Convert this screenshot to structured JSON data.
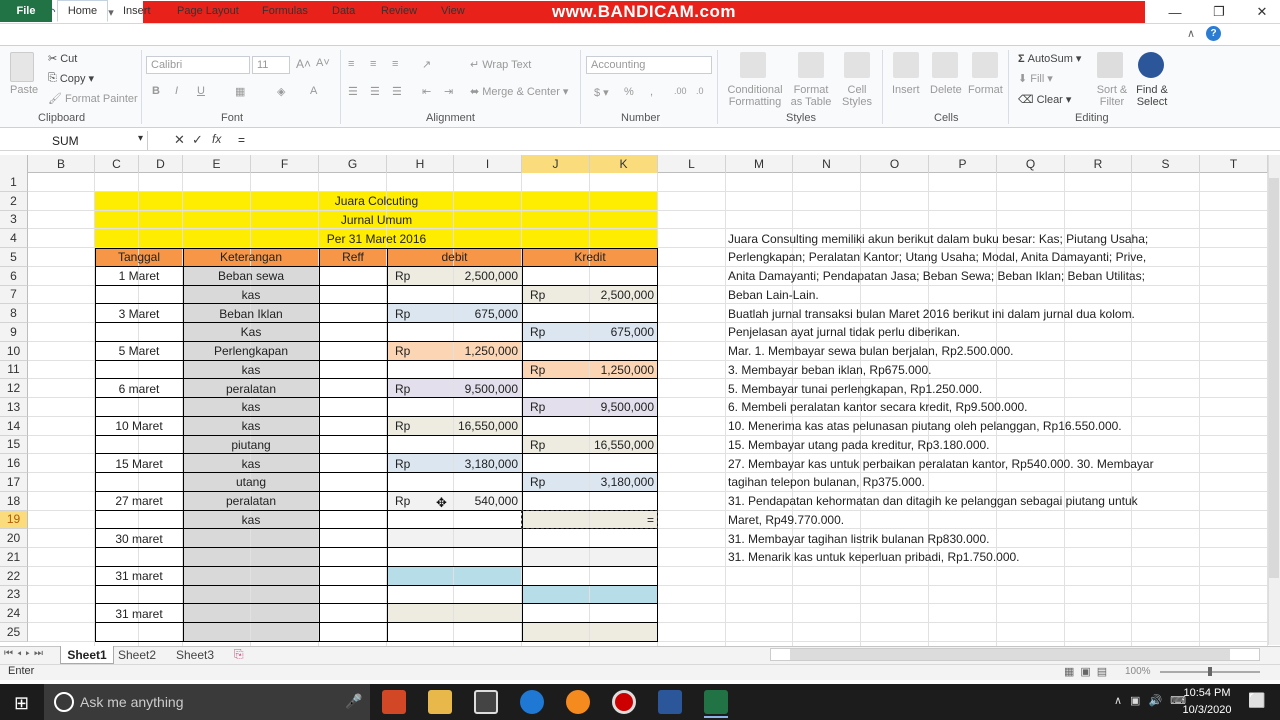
{
  "app": {
    "title_banner": "www.BANDICAM.com",
    "colors": {
      "excel_green": "#217346",
      "yellow": "#ffff00",
      "orange": "#f79646"
    }
  },
  "ribbon": {
    "tabs": [
      "File",
      "Home",
      "Insert",
      "Page Layout",
      "Formulas",
      "Data",
      "Review",
      "View"
    ],
    "clipboard": {
      "paste": "Paste",
      "cut": "Cut",
      "copy": "Copy",
      "format_painter": "Format Painter",
      "label": "Clipboard"
    },
    "font": {
      "name": "Calibri",
      "size": "11",
      "label": "Font"
    },
    "alignment": {
      "wrap": "Wrap Text",
      "merge": "Merge & Center",
      "label": "Alignment"
    },
    "number": {
      "format": "Accounting",
      "label": "Number"
    },
    "styles": {
      "conditional": "Conditional Formatting",
      "format_table": "Format as Table",
      "cell_styles": "Cell Styles",
      "label": "Styles"
    },
    "cells": {
      "insert": "Insert",
      "delete": "Delete",
      "format": "Format",
      "label": "Cells"
    },
    "editing": {
      "autosum": "AutoSum",
      "fill": "Fill",
      "clear": "Clear",
      "sort": "Sort & Filter",
      "find": "Find & Select",
      "label": "Editing"
    }
  },
  "formula_bar": {
    "name_box": "SUM",
    "value": "="
  },
  "columns": [
    "B",
    "C",
    "D",
    "E",
    "F",
    "G",
    "H",
    "I",
    "J",
    "K",
    "L",
    "M",
    "N",
    "O",
    "P",
    "Q",
    "R",
    "S",
    "T"
  ],
  "rows": [
    "1",
    "2",
    "3",
    "4",
    "5",
    "6",
    "7",
    "8",
    "9",
    "10",
    "11",
    "12",
    "13",
    "14",
    "15",
    "16",
    "17",
    "18",
    "19",
    "20",
    "21",
    "22",
    "23",
    "24",
    "25"
  ],
  "journal": {
    "title": "Juara Colcuting",
    "subtitle": "Jurnal Umum",
    "date": "Per 31 Maret 2016",
    "headers": {
      "tanggal": "Tanggal",
      "keterangan": "Keterangan",
      "reff": "Reff",
      "debit": "debit",
      "kredit": "Kredit"
    },
    "entries": [
      {
        "row": "6",
        "tanggal": "1 Maret",
        "ket": "Beban sewa",
        "side": "D",
        "rp": "Rp",
        "amt": "2,500,000"
      },
      {
        "row": "7",
        "tanggal": "",
        "ket": "kas",
        "side": "K",
        "rp": "Rp",
        "amt": "2,500,000"
      },
      {
        "row": "8",
        "tanggal": "3 Maret",
        "ket": "Beban Iklan",
        "side": "D",
        "rp": "Rp",
        "amt": "675,000"
      },
      {
        "row": "9",
        "tanggal": "",
        "ket": "Kas",
        "side": "K",
        "rp": "Rp",
        "amt": "675,000"
      },
      {
        "row": "10",
        "tanggal": "5 Maret",
        "ket": "Perlengkapan",
        "side": "D",
        "rp": "Rp",
        "amt": "1,250,000"
      },
      {
        "row": "11",
        "tanggal": "",
        "ket": "kas",
        "side": "K",
        "rp": "Rp",
        "amt": "1,250,000"
      },
      {
        "row": "12",
        "tanggal": "6 maret",
        "ket": "peralatan",
        "side": "D",
        "rp": "Rp",
        "amt": "9,500,000"
      },
      {
        "row": "13",
        "tanggal": "",
        "ket": "kas",
        "side": "K",
        "rp": "Rp",
        "amt": "9,500,000"
      },
      {
        "row": "14",
        "tanggal": "10 Maret",
        "ket": "kas",
        "side": "D",
        "rp": "Rp",
        "amt": "16,550,000"
      },
      {
        "row": "15",
        "tanggal": "",
        "ket": "piutang",
        "side": "K",
        "rp": "Rp",
        "amt": "16,550,000"
      },
      {
        "row": "16",
        "tanggal": "15 Maret",
        "ket": "kas",
        "side": "D",
        "rp": "Rp",
        "amt": "3,180,000"
      },
      {
        "row": "17",
        "tanggal": "",
        "ket": "utang",
        "side": "K",
        "rp": "Rp",
        "amt": "3,180,000"
      },
      {
        "row": "18",
        "tanggal": "27 maret",
        "ket": "peralatan",
        "side": "D",
        "rp": "Rp",
        "amt": "540,000"
      },
      {
        "row": "19",
        "tanggal": "",
        "ket": "kas",
        "side": "K",
        "rp": "",
        "amt": "="
      },
      {
        "row": "20",
        "tanggal": "30 maret",
        "ket": "",
        "side": "",
        "rp": "",
        "amt": ""
      },
      {
        "row": "22",
        "tanggal": "31 maret",
        "ket": "",
        "side": "",
        "rp": "",
        "amt": ""
      },
      {
        "row": "24",
        "tanggal": "31 maret",
        "ket": "",
        "side": "",
        "rp": "",
        "amt": ""
      }
    ]
  },
  "notes": [
    "Juara Consulting memiliki akun berikut dalam buku besar: Kas;  Piutang Usaha;",
    "Perlengkapan;  Peralatan Kantor;  Utang Usaha;  Modal, Anita Damayanti;  Prive,",
    "Anita Damayanti;  Pendapatan Jasa;  Beban Sewa;  Beban Iklan;  Beban Utilitas;",
    "Beban Lain-Lain.",
    "Buatlah jurnal transaksi bulan Maret 2016 berikut ini dalam jurnal dua kolom.",
    "Penjelasan ayat jurnal tidak perlu diberikan.",
    "Mar. 1. Membayar sewa bulan berjalan, Rp2.500.000.",
    "3. Membayar beban iklan, Rp675.000.",
    "5. Membayar tunai perlengkapan, Rp1.250.000.",
    "6. Membeli peralatan kantor secara kredit, Rp9.500.000.",
    "10. Menerima kas atas pelunasan piutang oleh pelanggan, Rp16.550.000.",
    " 15. Membayar utang pada kreditur, Rp3.180.000.",
    "27. Membayar kas untuk perbaikan peralatan kantor, Rp540.000.  30. Membayar",
    "tagihan telepon bulanan, Rp375.000.",
    "31. Pendapatan kehormatan dan ditagih ke pelanggan sebagai piutang untuk",
    "Maret, Rp49.770.000.",
    "31. Membayar tagihan listrik bulanan Rp830.000.",
    "31. Menarik kas untuk keperluan pribadi, Rp1.750.000."
  ],
  "sheets": [
    "Sheet1",
    "Sheet2",
    "Sheet3"
  ],
  "status": {
    "mode": "Enter",
    "zoom": "100%"
  },
  "taskbar": {
    "search": "Ask me anything",
    "time": "10:54 PM",
    "date": "10/3/2020"
  }
}
